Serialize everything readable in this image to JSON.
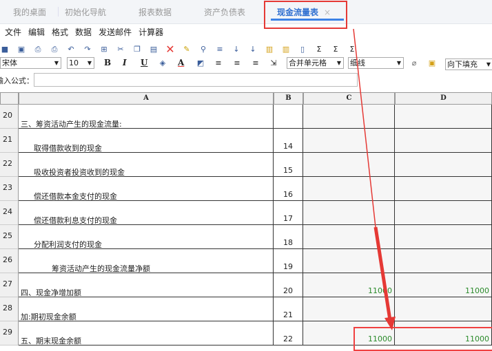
{
  "tabs": [
    {
      "label": "我的桌面"
    },
    {
      "label": "初始化导航"
    },
    {
      "label": "报表数据"
    },
    {
      "label": "资产负债表"
    },
    {
      "label": "现金流量表",
      "active": true
    }
  ],
  "tab_close": "×",
  "menu": [
    "文件",
    "编辑",
    "格式",
    "数据",
    "发送邮件",
    "计算器"
  ],
  "toolbar": {
    "font": "宋体",
    "size": "10",
    "bold": "B",
    "italic": "I",
    "underline": "U",
    "font_color": "A",
    "merge": "合并单元格",
    "border": "细线",
    "fill": "向下填充"
  },
  "formula": {
    "label": "输入公式：",
    "value": ""
  },
  "columns": [
    "A",
    "B",
    "C",
    "D"
  ],
  "rows": [
    {
      "n": "20",
      "a": "三、筹资活动产生的现金流量:",
      "indent": 0,
      "b": "",
      "c": "",
      "d": ""
    },
    {
      "n": "21",
      "a": "取得借款收到的现金",
      "indent": 1,
      "b": "14",
      "c": "",
      "d": ""
    },
    {
      "n": "22",
      "a": "吸收投资者投资收到的现金",
      "indent": 1,
      "b": "15",
      "c": "",
      "d": ""
    },
    {
      "n": "23",
      "a": "偿还借款本金支付的现金",
      "indent": 1,
      "b": "16",
      "c": "",
      "d": ""
    },
    {
      "n": "24",
      "a": "偿还借款利息支付的现金",
      "indent": 1,
      "b": "17",
      "c": "",
      "d": ""
    },
    {
      "n": "25",
      "a": "分配利润支付的现金",
      "indent": 1,
      "b": "18",
      "c": "",
      "d": ""
    },
    {
      "n": "26",
      "a": "筹资活动产生的现金流量净额",
      "indent": 2,
      "b": "19",
      "c": "",
      "d": ""
    },
    {
      "n": "27",
      "a": "四、现金净增加额",
      "indent": 0,
      "b": "20",
      "c": "11000",
      "d": "11000"
    },
    {
      "n": "28",
      "a": "加:期初现金余额",
      "indent": 0,
      "b": "21",
      "c": "",
      "d": ""
    },
    {
      "n": "29",
      "a": "五、期末现金余额",
      "indent": 0,
      "b": "22",
      "c": "11000",
      "d": "11000"
    }
  ],
  "colors": {
    "accent": "#3c82e6",
    "highlight": "#e53935",
    "value": "#2a8a2a"
  }
}
